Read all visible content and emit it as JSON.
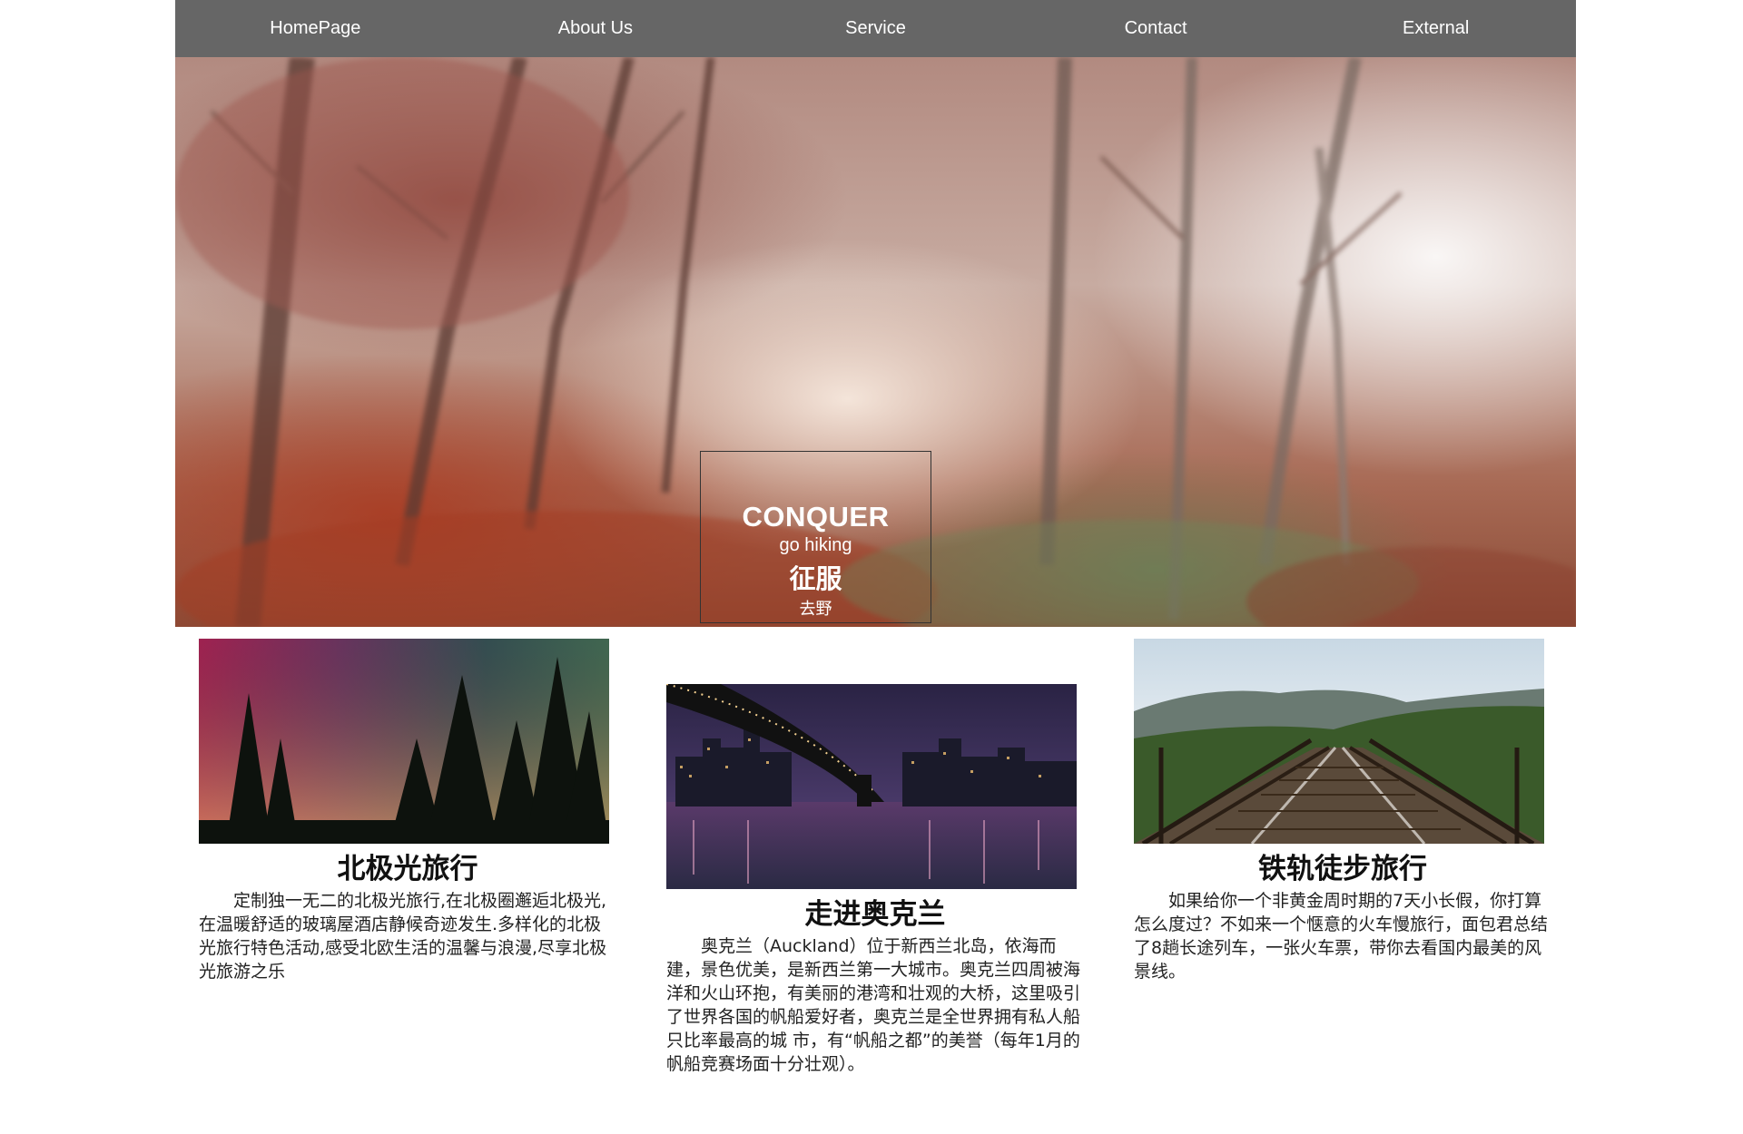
{
  "nav": {
    "items": [
      {
        "label": "HomePage"
      },
      {
        "label": "About Us"
      },
      {
        "label": "Service"
      },
      {
        "label": "Contact"
      },
      {
        "label": "External"
      }
    ]
  },
  "hero": {
    "title": "CONQUER",
    "subtitle": "go hiking",
    "title_cn": "征服",
    "subtitle_cn": "去野"
  },
  "cards": [
    {
      "title": "北极光旅行",
      "text": "定制独一无二的北极光旅行,在北极圈邂逅北极光,在温暖舒适的玻璃屋酒店静候奇迹发生.多样化的北极光旅行特色活动,感受北欧生活的温馨与浪漫,尽享北极光旅游之乐"
    },
    {
      "title": "走进奥克兰",
      "text": "奥克兰（Auckland）位于新西兰北岛，依海而建，景色优美，是新西兰第一大城市。奥克兰四周被海洋和火山环抱，有美丽的港湾和壮观的大桥，这里吸引了世界各国的帆船爱好者，奥克兰是全世界拥有私人船只比率最高的城 市，有“帆船之都”的美誉（每年1月的帆船竞赛场面十分壮观）。"
    },
    {
      "title": "铁轨徒步旅行",
      "text": "如果给你一个非黄金周时期的7天小长假，你打算怎么度过？不如来一个惬意的火车慢旅行，面包君总结了8趟长途列车，一张火车票，带你去看国内最美的风景线。"
    }
  ],
  "colors": {
    "nav_bg": "#666666",
    "nav_text": "#ffffff"
  }
}
